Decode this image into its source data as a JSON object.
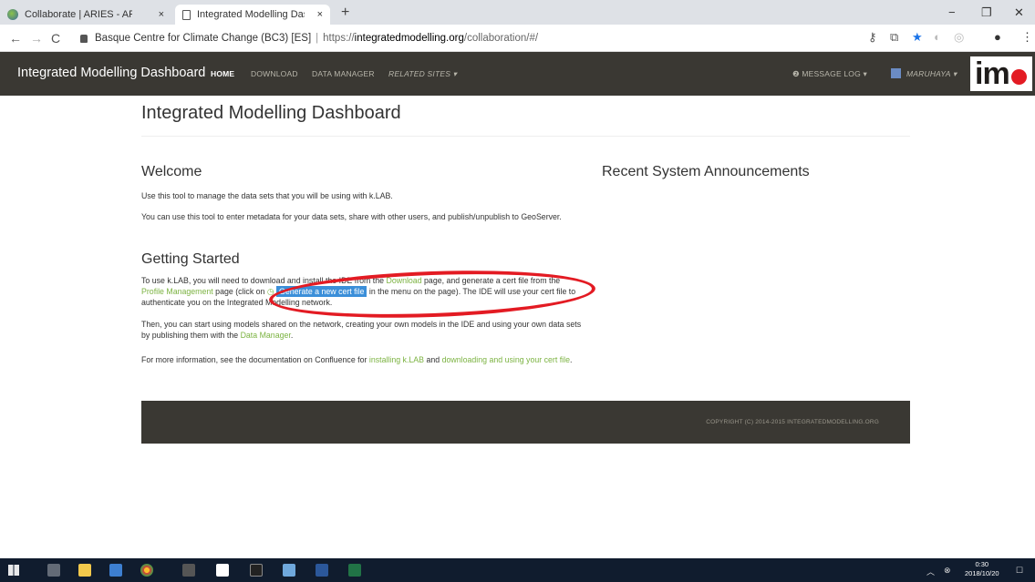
{
  "browser": {
    "tabs": [
      {
        "title": "Collaborate | ARIES - ARtificial In",
        "close": "×"
      },
      {
        "title": "Integrated Modelling Dashboard",
        "close": "×"
      }
    ],
    "new_tab": "+",
    "window_controls": {
      "minimize": "−",
      "maximize": "❐",
      "close": "✕"
    },
    "nav": {
      "back": "←",
      "forward": "→",
      "reload": "C"
    },
    "address": {
      "site_identity": "Basque Centre for Climate Change (BC3) [ES]",
      "separator": "|",
      "url_prefix": "https://",
      "url_host": "integratedmodelling.org",
      "url_path": "/collaboration/#/"
    }
  },
  "navbar": {
    "brand": "Integrated Modelling Dashboard",
    "links": {
      "home": "HOME",
      "download": "DOWNLOAD",
      "data_manager": "DATA MANAGER",
      "related_sites": "RELATED SITES ▾"
    },
    "message_log": "❷ MESSAGE LOG ▾",
    "user": "MARUHAYA ▾",
    "logo_text": "im"
  },
  "page": {
    "title": "Integrated Modelling Dashboard",
    "welcome": {
      "heading": "Welcome",
      "p1": "Use this tool to manage the data sets that you will be using with k.LAB.",
      "p2": "You can use this tool to enter metadata for your data sets, share with other users, and publish/unpublish to GeoServer."
    },
    "getting_started": {
      "heading": "Getting Started",
      "p1_a": "To use k.LAB, you will need to download and install the IDE from the ",
      "p1_link_download": "Download",
      "p1_b": " page, and generate a cert file from the ",
      "p1_link_profile": "Profile Management",
      "p1_c": " page (click on ",
      "p1_highlight": "Generate a new cert file",
      "p1_d": " in the menu on the page). The IDE will use your cert file to authenticate you on the Integrated Modelling network.",
      "p2_a": "Then, you can start using models shared on the network, creating your own models in the IDE and using your own data sets by publishing them with the ",
      "p2_link": "Data Manager",
      "p2_b": ".",
      "p3_a": "For more information, see the documentation on Confluence for ",
      "p3_link1": "installing k.LAB",
      "p3_b": " and ",
      "p3_link2": "downloading and using your cert file",
      "p3_c": "."
    },
    "announcements": {
      "heading": "Recent System Announcements"
    },
    "footer": {
      "copyright": "COPYRIGHT (C) 2014-2015 INTEGRATEDMODELLING.ORG"
    }
  },
  "taskbar": {
    "clock_time": "0:30",
    "clock_date": "2018/10/20"
  },
  "colors": {
    "navbar": "#3a3833",
    "link": "#7cb342",
    "highlight": "#3b8fd9",
    "annotation": "#e31b23",
    "taskbar": "#101c2e"
  }
}
